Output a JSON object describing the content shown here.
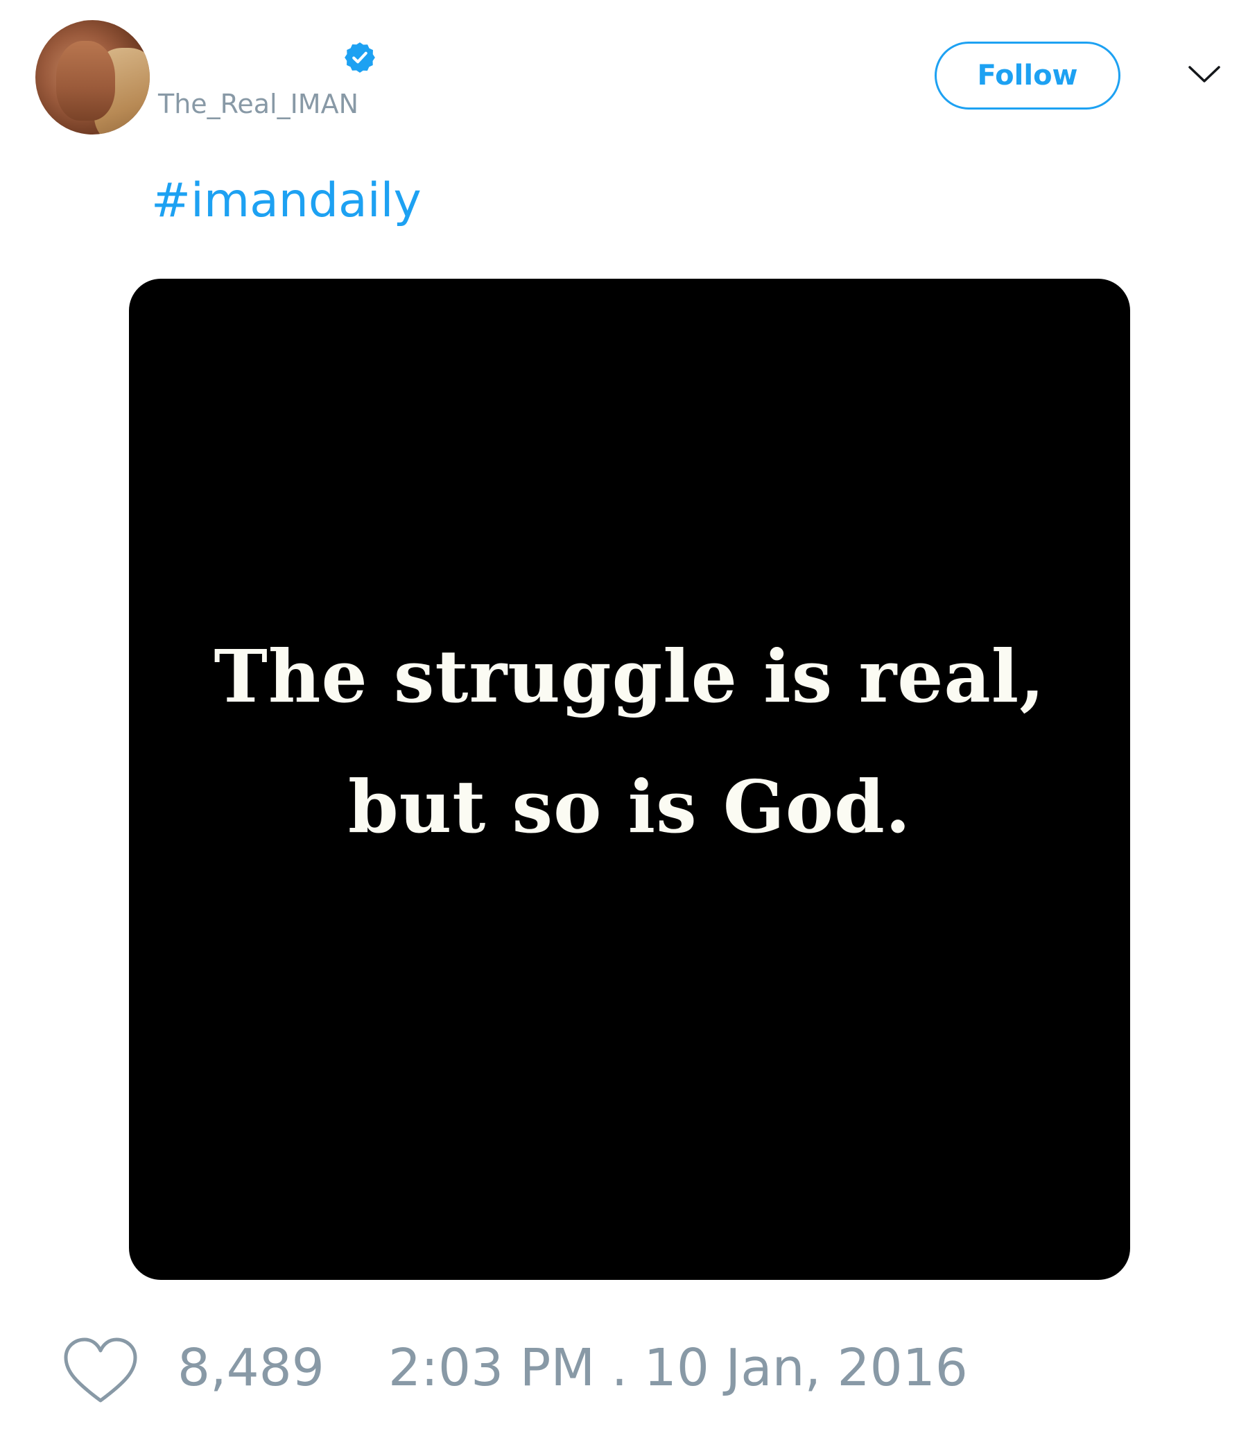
{
  "tweet": {
    "author": {
      "handle": "The_Real_IMAN",
      "verified_icon": "verified-badge-icon",
      "avatar": "profile-photo"
    },
    "follow_label": "Follow",
    "menu_icon": "chevron-down-icon",
    "text": "#imandaily",
    "media": {
      "quote_lines": [
        "The struggle is real,",
        "but so is God."
      ]
    },
    "likes": "8,489",
    "like_icon": "heart-icon",
    "timestamp": "2:03 PM . 10 Jan, 2016"
  },
  "colors": {
    "accent": "#1da1f2",
    "muted": "#8899a6",
    "media_bg": "#000000",
    "quote_text": "#fbfbf3"
  }
}
